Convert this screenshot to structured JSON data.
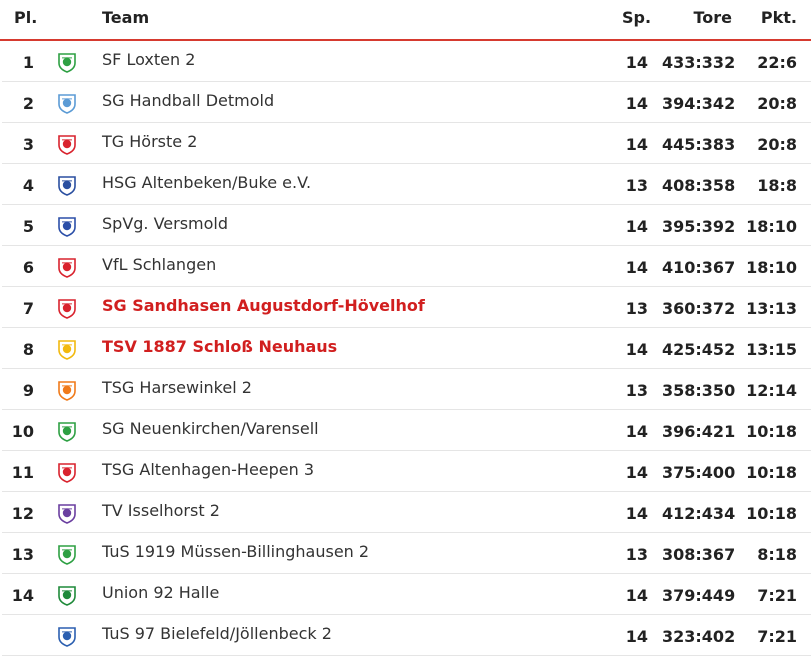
{
  "header": {
    "pl": "Pl.",
    "team": "Team",
    "sp": "Sp.",
    "tore": "Tore",
    "pkt": "Pkt."
  },
  "rows": [
    {
      "pl": "1",
      "team": "SF Loxten 2",
      "sp": "14",
      "tore": "433:332",
      "pkt": "22:6",
      "highlight": false,
      "logo": "loxten-logo-icon",
      "color": "#2ea043"
    },
    {
      "pl": "2",
      "team": "SG Handball Detmold",
      "sp": "14",
      "tore": "394:342",
      "pkt": "20:8",
      "highlight": false,
      "logo": "detmold-logo-icon",
      "color": "#5b9bd5"
    },
    {
      "pl": "3",
      "team": "TG Hörste 2",
      "sp": "14",
      "tore": "445:383",
      "pkt": "20:8",
      "highlight": false,
      "logo": "hoerste-logo-icon",
      "color": "#d9232e"
    },
    {
      "pl": "4",
      "team": "HSG Altenbeken/Buke e.V.",
      "sp": "13",
      "tore": "408:358",
      "pkt": "18:8",
      "highlight": false,
      "logo": "altenbeken-logo-icon",
      "color": "#2a4fa0"
    },
    {
      "pl": "5",
      "team": "SpVg. Versmold",
      "sp": "14",
      "tore": "395:392",
      "pkt": "18:10",
      "highlight": false,
      "logo": "versmold-logo-icon",
      "color": "#2b4fa8"
    },
    {
      "pl": "6",
      "team": "VfL Schlangen",
      "sp": "14",
      "tore": "410:367",
      "pkt": "18:10",
      "highlight": false,
      "logo": "schlangen-logo-icon",
      "color": "#d9232e"
    },
    {
      "pl": "7",
      "team": "SG Sandhasen Augustdorf-Hövelhof",
      "sp": "13",
      "tore": "360:372",
      "pkt": "13:13",
      "highlight": true,
      "logo": "sandhasen-logo-icon",
      "color": "#d9232e"
    },
    {
      "pl": "8",
      "team": "TSV 1887 Schloß Neuhaus",
      "sp": "14",
      "tore": "425:452",
      "pkt": "13:15",
      "highlight": true,
      "logo": "neuhaus-logo-icon",
      "color": "#f2b90f"
    },
    {
      "pl": "9",
      "team": "TSG Harsewinkel 2",
      "sp": "13",
      "tore": "358:350",
      "pkt": "12:14",
      "highlight": false,
      "logo": "harsewinkel-logo-icon",
      "color": "#f07a1a"
    },
    {
      "pl": "10",
      "team": "SG Neuenkirchen/Varensell",
      "sp": "14",
      "tore": "396:421",
      "pkt": "10:18",
      "highlight": false,
      "logo": "neuenkirchen-logo-icon",
      "color": "#2ea043"
    },
    {
      "pl": "11",
      "team": "TSG Altenhagen-Heepen 3",
      "sp": "14",
      "tore": "375:400",
      "pkt": "10:18",
      "highlight": false,
      "logo": "heepen-logo-icon",
      "color": "#d9232e"
    },
    {
      "pl": "12",
      "team": "TV Isselhorst 2",
      "sp": "14",
      "tore": "412:434",
      "pkt": "10:18",
      "highlight": false,
      "logo": "isselhorst-logo-icon",
      "color": "#6a3fa0"
    },
    {
      "pl": "13",
      "team": "TuS 1919 Müssen-Billinghausen 2",
      "sp": "13",
      "tore": "308:367",
      "pkt": "8:18",
      "highlight": false,
      "logo": "muessen-logo-icon",
      "color": "#2ea043"
    },
    {
      "pl": "14",
      "team": "Union 92 Halle",
      "sp": "14",
      "tore": "379:449",
      "pkt": "7:21",
      "highlight": false,
      "logo": "halle-logo-icon",
      "color": "#1f8a3a"
    },
    {
      "pl": "",
      "team": "TuS 97 Bielefeld/Jöllenbeck 2",
      "sp": "14",
      "tore": "323:402",
      "pkt": "7:21",
      "highlight": false,
      "logo": "joellenbeck-logo-icon",
      "color": "#2b5fb0"
    }
  ]
}
